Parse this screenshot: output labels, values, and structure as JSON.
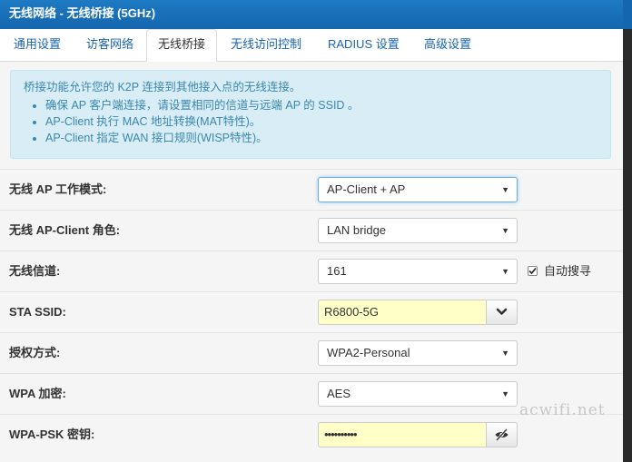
{
  "window": {
    "title": "无线网络 - 无线桥接 (5GHz)"
  },
  "tabs": [
    {
      "label": "通用设置",
      "active": false
    },
    {
      "label": "访客网络",
      "active": false
    },
    {
      "label": "无线桥接",
      "active": true
    },
    {
      "label": "无线访问控制",
      "active": false
    },
    {
      "label": "RADIUS 设置",
      "active": false
    },
    {
      "label": "高级设置",
      "active": false
    }
  ],
  "info": {
    "intro": "桥接功能允许您的 K2P 连接到其他接入点的无线连接。",
    "bullets": [
      "确保 AP 客户端连接，请设置相同的信道与远端 AP 的 SSID 。",
      "AP-Client 执行 MAC 地址转换(MAT特性)。",
      "AP-Client 指定 WAN 接口规则(WISP特性)。"
    ]
  },
  "form": {
    "ap_mode": {
      "label": "无线 AP 工作模式:",
      "value": "AP-Client + AP"
    },
    "client_role": {
      "label": "无线 AP-Client 角色:",
      "value": "LAN bridge"
    },
    "channel": {
      "label": "无线信道:",
      "value": "161",
      "auto_scan_label": "自动搜寻",
      "auto_scan_checked": true
    },
    "sta_ssid": {
      "label": "STA SSID:",
      "value": "R6800-5G"
    },
    "auth_mode": {
      "label": "授权方式:",
      "value": "WPA2-Personal"
    },
    "wpa_encryption": {
      "label": "WPA 加密:",
      "value": "AES"
    },
    "wpa_psk": {
      "label": "WPA-PSK 密钥:",
      "value": "••••••••••"
    }
  },
  "icons": {
    "ssid_dropdown": "chevron-down-icon",
    "psk_toggle": "eye-slash-icon",
    "select_caret": "caret-down-icon"
  },
  "watermark": "acwifi.net",
  "colors": {
    "titlebar": "#1466ad",
    "link": "#1a65ad",
    "info_bg": "#d9edf7",
    "info_text": "#3a87ad",
    "input_highlight": "#ffffc8"
  }
}
